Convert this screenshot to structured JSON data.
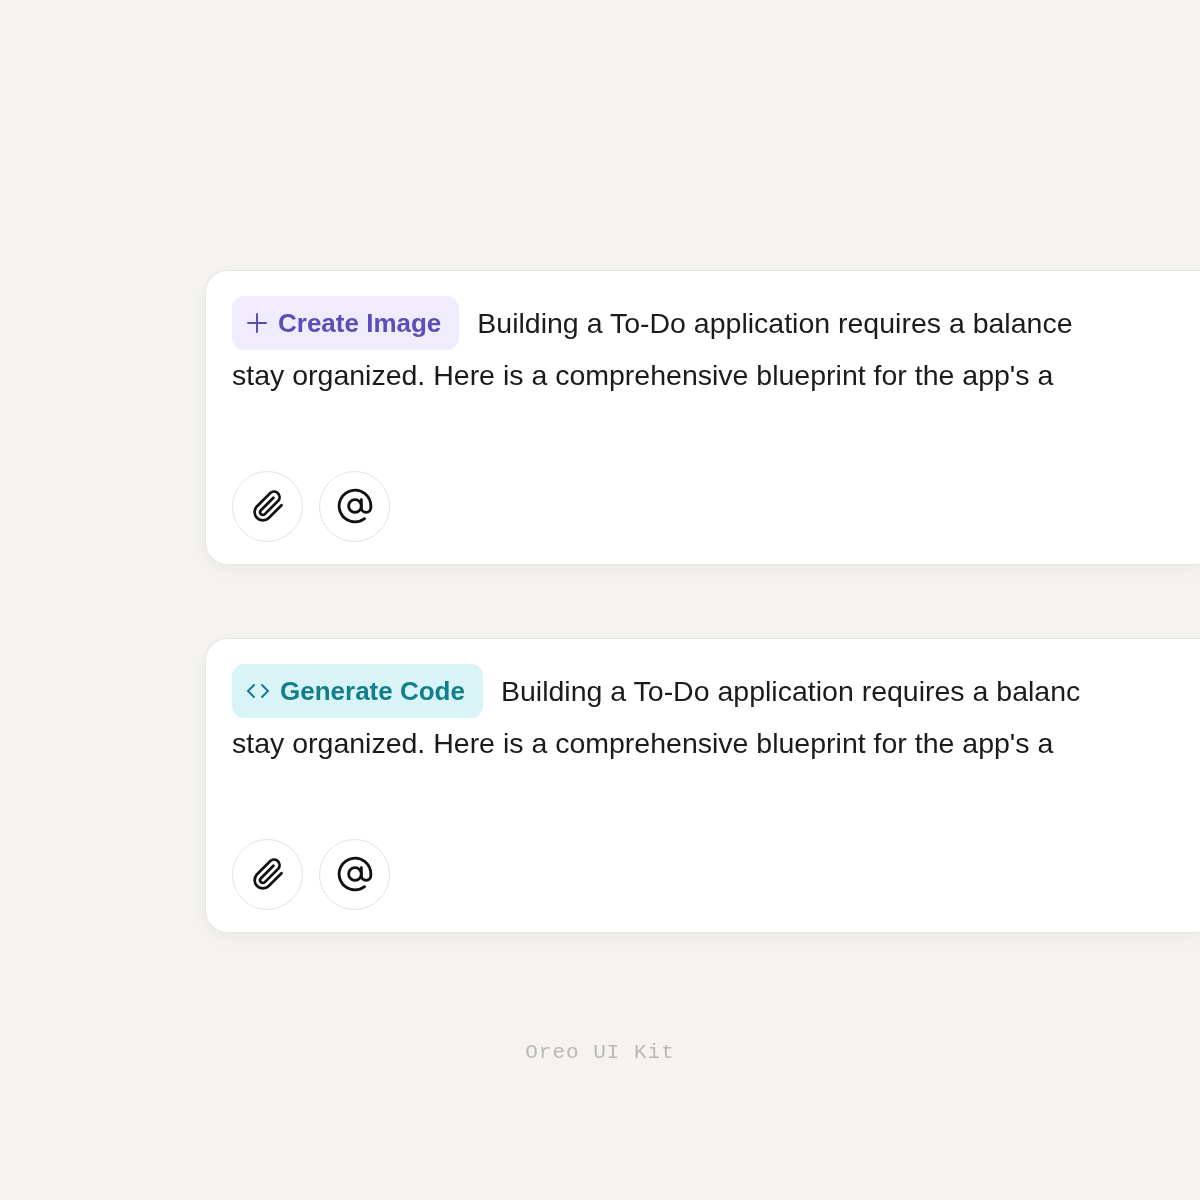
{
  "cards": [
    {
      "chip": {
        "kind": "image",
        "label": "Create Image"
      },
      "text_line_1": "Building a To-Do application requires a balance",
      "text_line_2": "stay organized. Here is a comprehensive blueprint for the app's a"
    },
    {
      "chip": {
        "kind": "code",
        "label": "Generate Code"
      },
      "text_line_1": "Building a To-Do application requires a balanc",
      "text_line_2": "stay organized. Here is a comprehensive blueprint for the app's a"
    }
  ],
  "footer": "Oreo UI Kit"
}
